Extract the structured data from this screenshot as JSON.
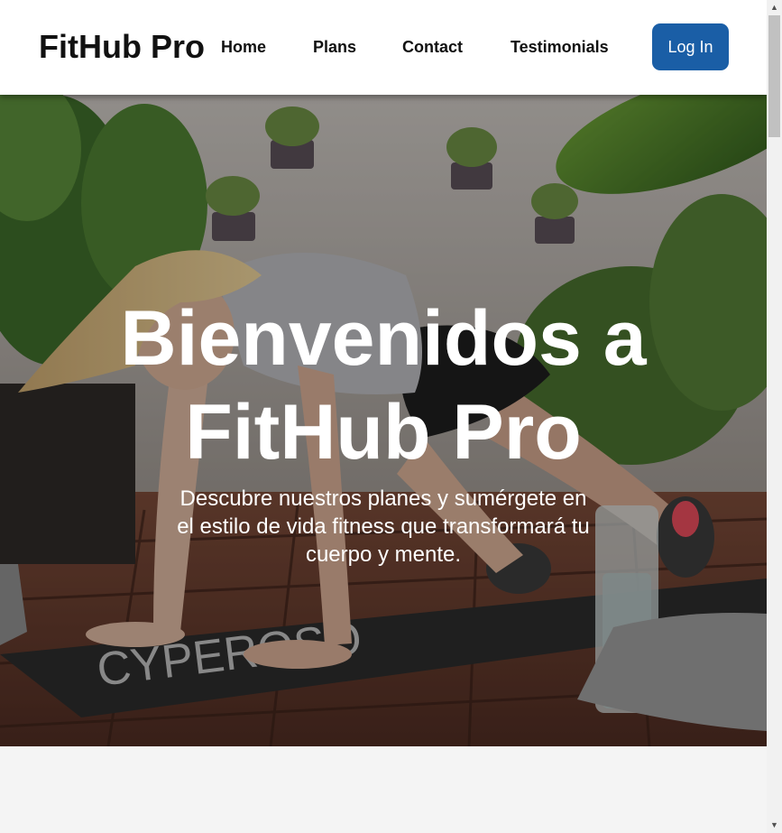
{
  "nav": {
    "brand": "FitHub Pro",
    "links": [
      {
        "label": "Home"
      },
      {
        "label": "Plans"
      },
      {
        "label": "Contact"
      },
      {
        "label": "Testimonials"
      }
    ],
    "login_label": "Log In"
  },
  "hero": {
    "title": "Bienvenidos a FitHub Pro",
    "subtitle": "Descubre nuestros planes y sumérgete en el estilo de vida fitness que transformará tu cuerpo y mente.",
    "mat_text": "CYPEROSO"
  },
  "colors": {
    "login_button": "#1a5ea6",
    "page_background": "#f4f4f4",
    "nav_background": "#ffffff"
  },
  "icons": {
    "scroll_up": "▲",
    "scroll_down": "▼"
  }
}
